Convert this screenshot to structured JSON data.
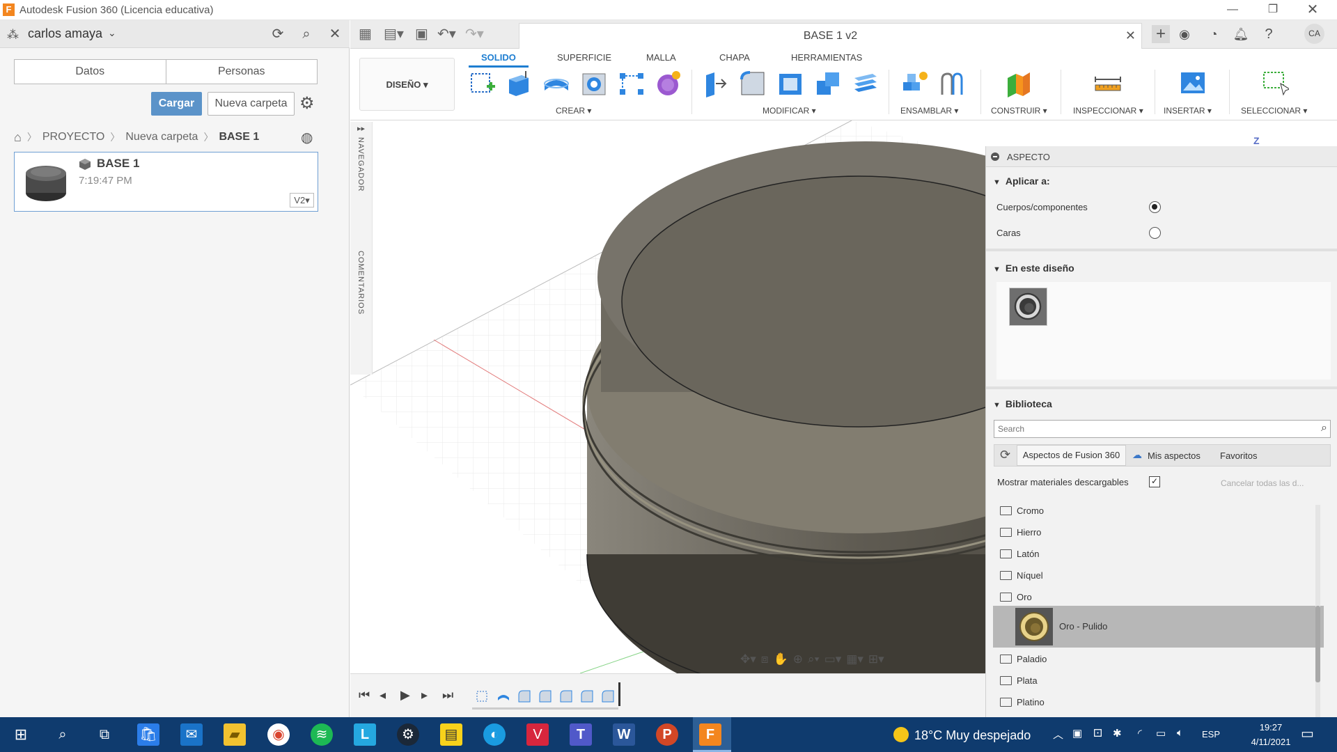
{
  "window": {
    "title": "Autodesk Fusion 360 (Licencia educativa)",
    "app_icon": "F",
    "controls": [
      "minimize-icon",
      "restore-icon",
      "close-icon"
    ]
  },
  "data_panel": {
    "user": "carlos amaya",
    "tabs": [
      "Datos",
      "Personas"
    ],
    "upload_button": "Cargar",
    "new_folder_button": "Nueva carpeta",
    "breadcrumb": [
      "PROYECTO",
      "Nueva carpeta",
      "BASE 1"
    ],
    "file": {
      "name": "BASE 1",
      "time": "7:19:47 PM",
      "version": "V2"
    }
  },
  "document": {
    "title": "BASE 1 v2"
  },
  "user_initials": "CA",
  "ribbon": {
    "workspace": "DISEÑO",
    "tabs": [
      "SOLIDO",
      "SUPERFICIE",
      "MALLA",
      "CHAPA",
      "HERRAMIENTAS"
    ],
    "active_tab": "SOLIDO",
    "groups": [
      "CREAR",
      "MODIFICAR",
      "ENSAMBLAR",
      "CONSTRUIR",
      "INSPECCIONAR",
      "INSERTAR",
      "SELECCIONAR"
    ]
  },
  "side_strip": {
    "navigator": "NAVEGADOR",
    "comments": "COMENTARIOS"
  },
  "viewcube_label": "Z",
  "appearance_panel": {
    "title": "ASPECTO",
    "apply_to": {
      "heading": "Aplicar a:",
      "options": [
        {
          "label": "Cuerpos/componentes",
          "selected": true
        },
        {
          "label": "Caras",
          "selected": false
        }
      ]
    },
    "in_design_heading": "En este diseño",
    "library": {
      "heading": "Biblioteca",
      "search_placeholder": "Search",
      "tabs": [
        "Aspectos de Fusion 360",
        "Mis aspectos",
        "Favoritos"
      ],
      "show_downloadable_label": "Mostrar materiales descargables",
      "show_downloadable_checked": true,
      "cancel_all": "Cancelar todas las d...",
      "folders": [
        "Cromo",
        "Hierro",
        "Latón",
        "Níquel",
        "Oro",
        "Paladio",
        "Plata",
        "Platino"
      ],
      "selected_item": "Oro - Pulido"
    }
  },
  "taskbar": {
    "weather": "18°C  Muy despejado",
    "language": "ESP",
    "time": "19:27",
    "date": "4/11/2021"
  }
}
